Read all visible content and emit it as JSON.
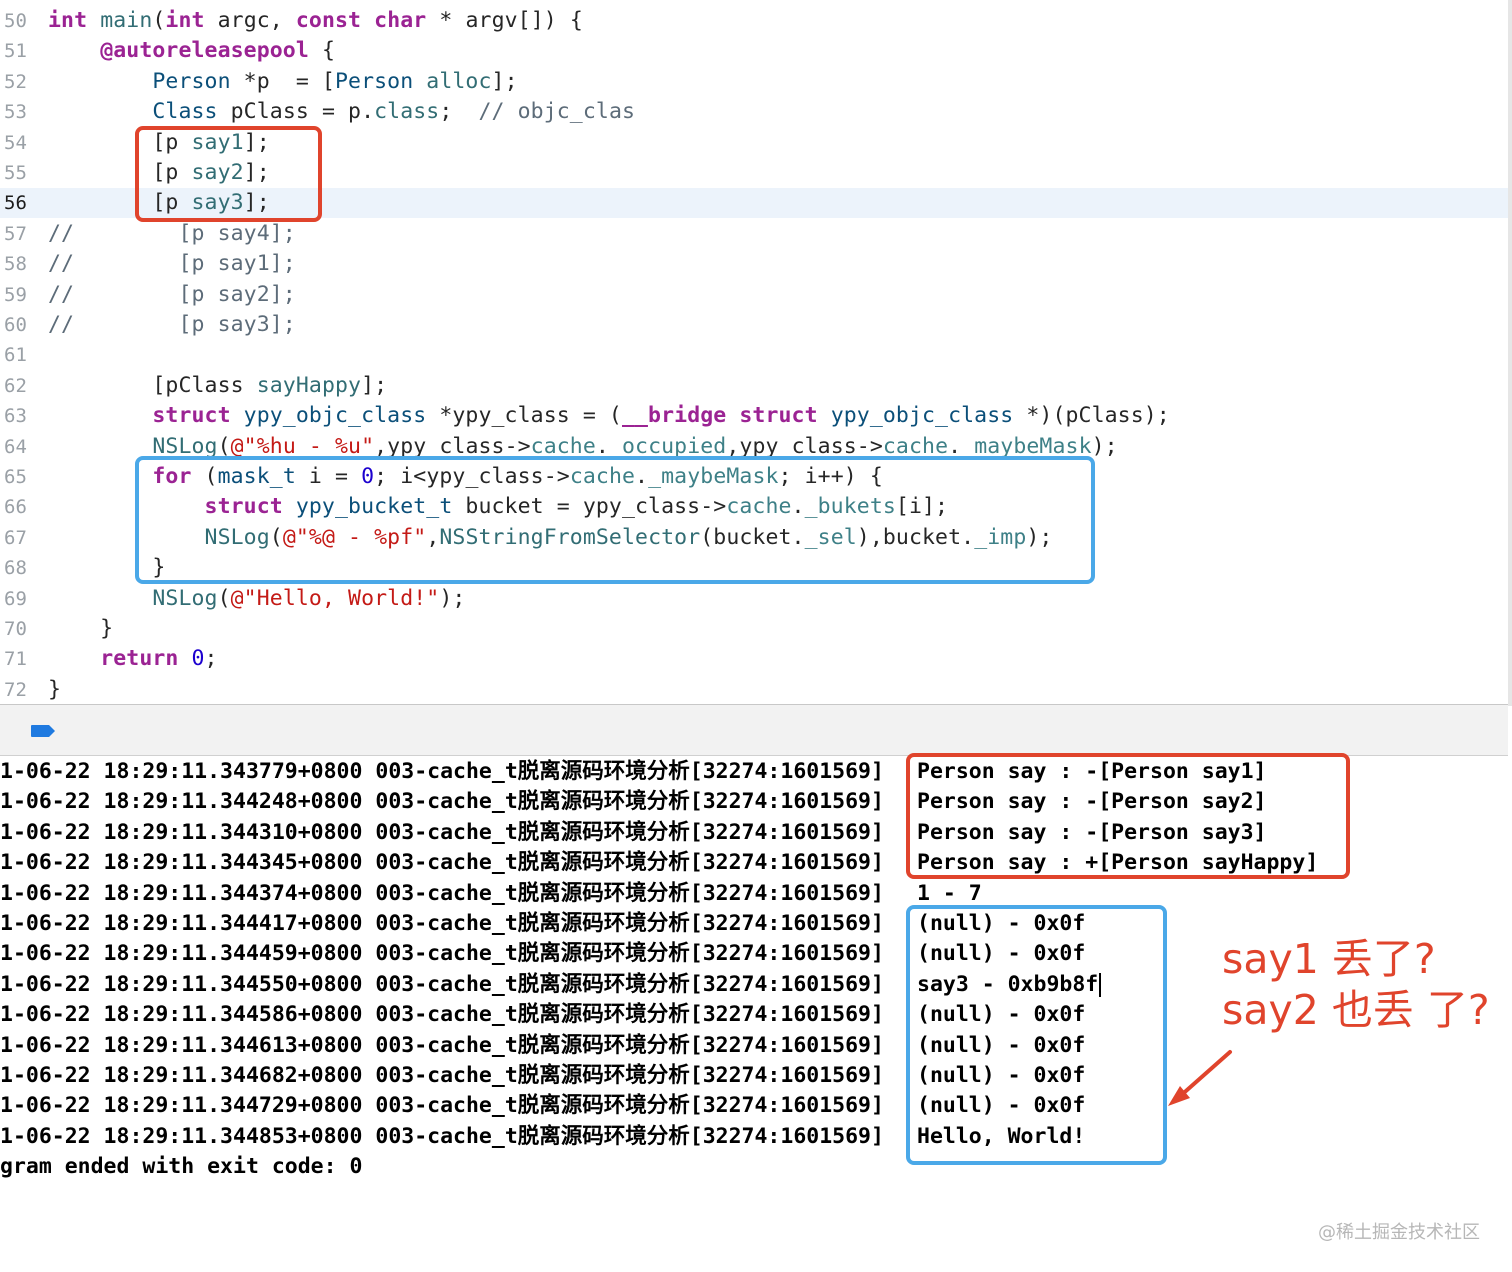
{
  "editor": {
    "current_line": "56",
    "lines": [
      {
        "num": "50",
        "segs": [
          [
            "kw",
            "int"
          ],
          [
            "p",
            " "
          ],
          [
            "mt",
            "main"
          ],
          [
            "p",
            "("
          ],
          [
            "kw",
            "int"
          ],
          [
            "p",
            " argc, "
          ],
          [
            "kw",
            "const"
          ],
          [
            "p",
            " "
          ],
          [
            "kw",
            "char"
          ],
          [
            "p",
            " * argv[]) {"
          ]
        ]
      },
      {
        "num": "51",
        "segs": [
          [
            "p",
            "    "
          ],
          [
            "kw",
            "@autoreleasepool"
          ],
          [
            "p",
            " {"
          ]
        ]
      },
      {
        "num": "52",
        "segs": [
          [
            "p",
            "        "
          ],
          [
            "ty",
            "Person"
          ],
          [
            "p",
            " *p  = ["
          ],
          [
            "ty",
            "Person"
          ],
          [
            "p",
            " "
          ],
          [
            "mt",
            "alloc"
          ],
          [
            "p",
            "];"
          ]
        ]
      },
      {
        "num": "53",
        "segs": [
          [
            "p",
            "        "
          ],
          [
            "ty",
            "Class"
          ],
          [
            "p",
            " pClass = p."
          ],
          [
            "mt",
            "class"
          ],
          [
            "p",
            ";  "
          ],
          [
            "cm",
            "// objc_clas"
          ]
        ]
      },
      {
        "num": "54",
        "segs": [
          [
            "p",
            "        [p "
          ],
          [
            "mt",
            "say1"
          ],
          [
            "p",
            "];"
          ]
        ]
      },
      {
        "num": "55",
        "segs": [
          [
            "p",
            "        [p "
          ],
          [
            "mt",
            "say2"
          ],
          [
            "p",
            "];"
          ]
        ]
      },
      {
        "num": "56",
        "segs": [
          [
            "p",
            "        [p "
          ],
          [
            "mt",
            "say3"
          ],
          [
            "p",
            "];"
          ]
        ]
      },
      {
        "num": "57",
        "segs": [
          [
            "cm",
            "//        [p say4];"
          ]
        ]
      },
      {
        "num": "58",
        "segs": [
          [
            "cm",
            "//        [p say1];"
          ]
        ]
      },
      {
        "num": "59",
        "segs": [
          [
            "cm",
            "//        [p say2];"
          ]
        ]
      },
      {
        "num": "60",
        "segs": [
          [
            "cm",
            "//        [p say3];"
          ]
        ]
      },
      {
        "num": "61",
        "segs": [
          [
            "p",
            ""
          ]
        ]
      },
      {
        "num": "62",
        "segs": [
          [
            "p",
            "        [pClass "
          ],
          [
            "mt",
            "sayHappy"
          ],
          [
            "p",
            "];"
          ]
        ]
      },
      {
        "num": "63",
        "segs": [
          [
            "p",
            "        "
          ],
          [
            "kw",
            "struct"
          ],
          [
            "p",
            " "
          ],
          [
            "ty",
            "ypy_objc_class"
          ],
          [
            "p",
            " *ypy_class = ("
          ],
          [
            "kw",
            "__bridge"
          ],
          [
            "p",
            " "
          ],
          [
            "kw",
            "struct"
          ],
          [
            "p",
            " "
          ],
          [
            "ty",
            "ypy_objc_class"
          ],
          [
            "p",
            " *)(pClass);"
          ]
        ]
      },
      {
        "num": "64",
        "segs": [
          [
            "p",
            "        "
          ],
          [
            "mt",
            "NSLog"
          ],
          [
            "p",
            "("
          ],
          [
            "st",
            "@\"%hu - %u\""
          ],
          [
            "p",
            ",ypy_class->"
          ],
          [
            "pl",
            "cache"
          ],
          [
            "p",
            "."
          ],
          [
            "pl",
            "_occupied"
          ],
          [
            "p",
            ",ypy_class->"
          ],
          [
            "pl",
            "cache"
          ],
          [
            "p",
            "."
          ],
          [
            "pl",
            "_maybeMask"
          ],
          [
            "p",
            ");"
          ]
        ]
      },
      {
        "num": "65",
        "segs": [
          [
            "p",
            "        "
          ],
          [
            "kw",
            "for"
          ],
          [
            "p",
            " ("
          ],
          [
            "ty",
            "mask_t"
          ],
          [
            "p",
            " i = "
          ],
          [
            "nu",
            "0"
          ],
          [
            "p",
            "; i<ypy_class->"
          ],
          [
            "pl",
            "cache"
          ],
          [
            "p",
            "."
          ],
          [
            "pl",
            "_maybeMask"
          ],
          [
            "p",
            "; i++) {"
          ]
        ]
      },
      {
        "num": "66",
        "segs": [
          [
            "p",
            "            "
          ],
          [
            "kw",
            "struct"
          ],
          [
            "p",
            " "
          ],
          [
            "ty",
            "ypy_bucket_t"
          ],
          [
            "p",
            " bucket = ypy_class->"
          ],
          [
            "pl",
            "cache"
          ],
          [
            "p",
            "."
          ],
          [
            "pl",
            "_bukets"
          ],
          [
            "p",
            "[i];"
          ]
        ]
      },
      {
        "num": "67",
        "segs": [
          [
            "p",
            "            "
          ],
          [
            "mt",
            "NSLog"
          ],
          [
            "p",
            "("
          ],
          [
            "st",
            "@\"%@ - %pf\""
          ],
          [
            "p",
            ","
          ],
          [
            "mt",
            "NSStringFromSelector"
          ],
          [
            "p",
            "(bucket."
          ],
          [
            "pl",
            "_sel"
          ],
          [
            "p",
            "),bucket."
          ],
          [
            "pl",
            "_imp"
          ],
          [
            "p",
            ");"
          ]
        ]
      },
      {
        "num": "68",
        "segs": [
          [
            "p",
            "        }"
          ]
        ]
      },
      {
        "num": "69",
        "segs": [
          [
            "p",
            "        "
          ],
          [
            "mt",
            "NSLog"
          ],
          [
            "p",
            "("
          ],
          [
            "st",
            "@\"Hello, World!\""
          ],
          [
            "p",
            ");"
          ]
        ]
      },
      {
        "num": "70",
        "segs": [
          [
            "p",
            "    }"
          ]
        ]
      },
      {
        "num": "71",
        "segs": [
          [
            "p",
            "    "
          ],
          [
            "kw",
            "return"
          ],
          [
            "p",
            " "
          ],
          [
            "nu",
            "0"
          ],
          [
            "p",
            ";"
          ]
        ]
      },
      {
        "num": "72",
        "segs": [
          [
            "p",
            "}"
          ]
        ]
      }
    ]
  },
  "console": {
    "lines": [
      {
        "prefix": "1-06-22 18:29:11.343779+0800 003-cache_t脱离源码环境分析[32274:1601569]",
        "msg": "Person say : -[Person say1]"
      },
      {
        "prefix": "1-06-22 18:29:11.344248+0800 003-cache_t脱离源码环境分析[32274:1601569]",
        "msg": "Person say : -[Person say2]"
      },
      {
        "prefix": "1-06-22 18:29:11.344310+0800 003-cache_t脱离源码环境分析[32274:1601569]",
        "msg": "Person say : -[Person say3]"
      },
      {
        "prefix": "1-06-22 18:29:11.344345+0800 003-cache_t脱离源码环境分析[32274:1601569]",
        "msg": "Person say : +[Person sayHappy]"
      },
      {
        "prefix": "1-06-22 18:29:11.344374+0800 003-cache_t脱离源码环境分析[32274:1601569]",
        "msg": "1 - 7"
      },
      {
        "prefix": "1-06-22 18:29:11.344417+0800 003-cache_t脱离源码环境分析[32274:1601569]",
        "msg": "(null) - 0x0f"
      },
      {
        "prefix": "1-06-22 18:29:11.344459+0800 003-cache_t脱离源码环境分析[32274:1601569]",
        "msg": "(null) - 0x0f"
      },
      {
        "prefix": "1-06-22 18:29:11.344550+0800 003-cache_t脱离源码环境分析[32274:1601569]",
        "msg": "say3 - 0xb9b8f",
        "cursor": true
      },
      {
        "prefix": "1-06-22 18:29:11.344586+0800 003-cache_t脱离源码环境分析[32274:1601569]",
        "msg": "(null) - 0x0f"
      },
      {
        "prefix": "1-06-22 18:29:11.344613+0800 003-cache_t脱离源码环境分析[32274:1601569]",
        "msg": "(null) - 0x0f"
      },
      {
        "prefix": "1-06-22 18:29:11.344682+0800 003-cache_t脱离源码环境分析[32274:1601569]",
        "msg": "(null) - 0x0f"
      },
      {
        "prefix": "1-06-22 18:29:11.344729+0800 003-cache_t脱离源码环境分析[32274:1601569]",
        "msg": "(null) - 0x0f"
      },
      {
        "prefix": "1-06-22 18:29:11.344853+0800 003-cache_t脱离源码环境分析[32274:1601569]",
        "msg": "Hello, World!"
      },
      {
        "prefix": "gram ended with exit code: 0",
        "msg": ""
      }
    ]
  },
  "annotation": {
    "line1": "say1 丢了?",
    "line2": "say2 也丢 了?"
  },
  "watermark": "@稀土掘金技术社区",
  "colors": {
    "highlight_red": "#e0442c",
    "highlight_blue": "#4aa8e8",
    "current_line_bg": "#ecf3fb",
    "breakpoint_blue": "#1f7ae0"
  },
  "icons": {
    "breakpoint": "breakpoint-icon",
    "arrow": "arrow-icon"
  }
}
